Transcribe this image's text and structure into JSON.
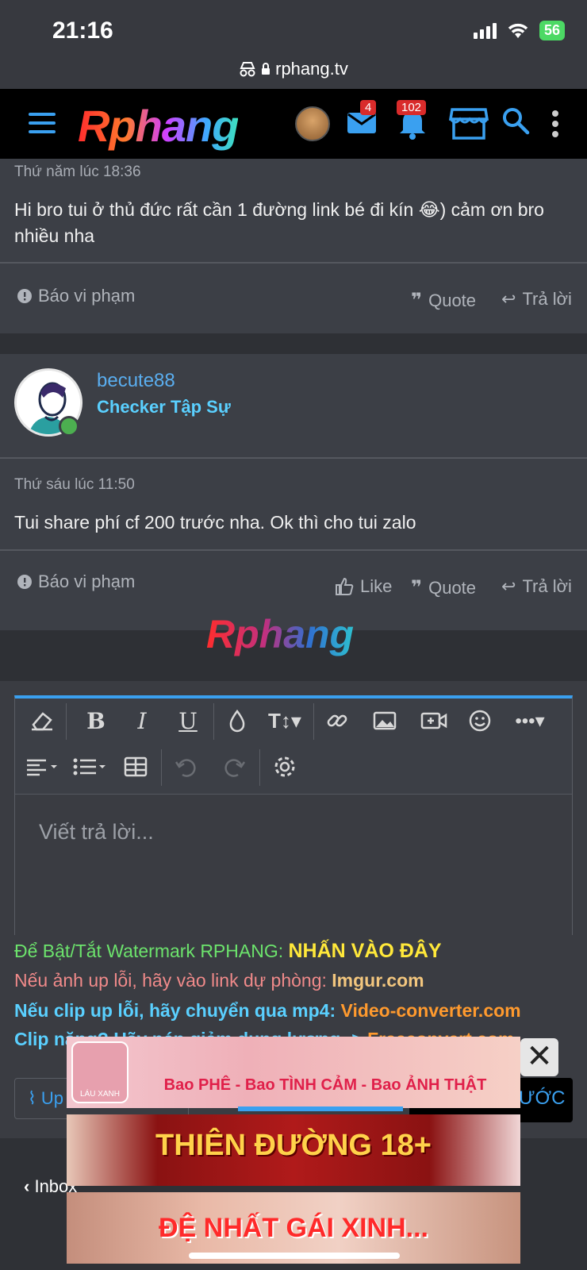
{
  "status": {
    "time": "21:16",
    "battery": "56",
    "url": "rphang.tv"
  },
  "navbar": {
    "logo": "Rphang",
    "messages_badge": "4",
    "notifications_badge": "102"
  },
  "post1": {
    "time": "Thứ năm lúc 18:36",
    "body": "Hi bro tui ở thủ đức rất cần 1 đường link bé đi kín 😂) cảm ơn bro nhiều nha",
    "report": "Báo vi phạm",
    "quote": "Quote",
    "reply": "Trả lời"
  },
  "post2": {
    "username": "becute88",
    "user_title": "Checker Tập Sự",
    "time": "Thứ sáu lúc 11:50",
    "body": "Tui share phí cf 200 trước nha. Ok thì cho tui zalo",
    "report": "Báo vi phạm",
    "like": "Like",
    "quote": "Quote",
    "reply": "Trả lời"
  },
  "watermark": "Rphang",
  "editor": {
    "placeholder": "Viết trả lời..."
  },
  "info": {
    "watermark_label": "Để Bật/Tắt Watermark RPHANG: ",
    "watermark_link": "NHẤN VÀO ĐÂY",
    "image_label": "Nếu ảnh up lỗi, hãy vào link dự phòng: ",
    "image_link": "Imgur.com",
    "clip_label": "Nếu clip up lỗi, hãy chuyển qua mp4: ",
    "clip_link": "Video-converter.com",
    "clip2_label": "Clip nặng? Hãy nén giảm dung lượng -> ",
    "clip2_link": "Freeconvert.com"
  },
  "upload_label": "Up",
  "submit_label": "ƯỚC",
  "bottom": {
    "inbox": "Inbox"
  },
  "ads": {
    "ad1_text": "Bao PHÊ - Bao TÌNH CẢM - Bao ẢNH THẬT",
    "ad1_logo": "LÁU XANH",
    "ad2_text": "THIÊN ĐƯỜNG 18+",
    "ad3_text": "ĐỆ NHẤT GÁI XINH..."
  }
}
